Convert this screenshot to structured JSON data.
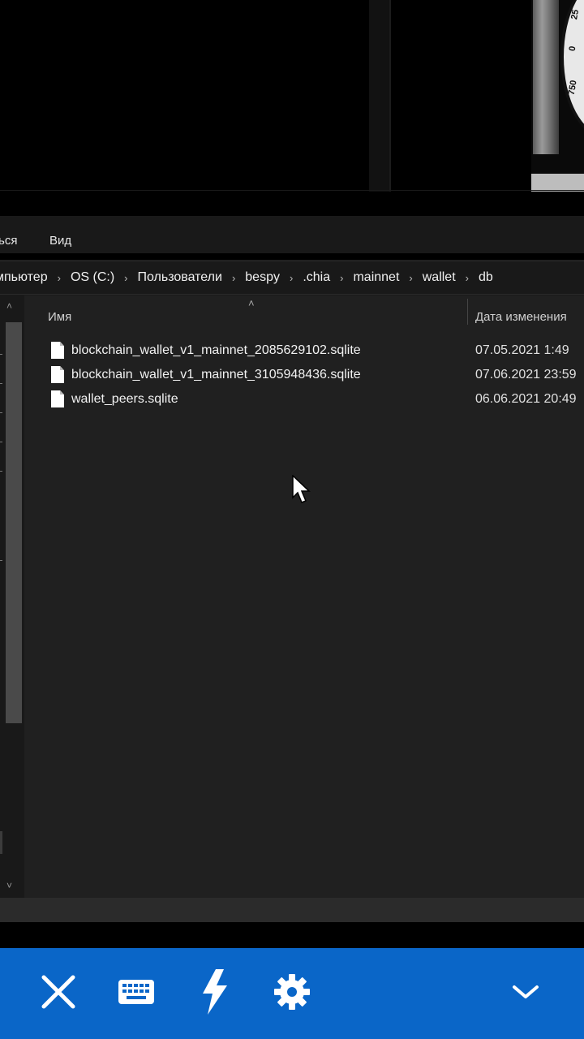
{
  "ribbon": {
    "share_label": "ься",
    "view_label": "Вид"
  },
  "breadcrumb": {
    "items": [
      "мпьютер",
      "OS (C:)",
      "Пользователи",
      "bespy",
      ".chia",
      "mainnet",
      "wallet",
      "db"
    ]
  },
  "columns": {
    "name": "Имя",
    "date": "Дата изменения"
  },
  "files": [
    {
      "name": "blockchain_wallet_v1_mainnet_2085629102.sqlite",
      "date": "07.05.2021 1:49"
    },
    {
      "name": "blockchain_wallet_v1_mainnet_3105948436.sqlite",
      "date": "07.06.2021 23:59"
    },
    {
      "name": "wallet_peers.sqlite",
      "date": "06.06.2021 20:49"
    }
  ],
  "background_photo": {
    "dial_numbers": [
      "25",
      "0",
      "750"
    ]
  },
  "toolbar": {
    "buttons": [
      "close-icon",
      "keyboard-icon",
      "lightning-icon",
      "gear-icon",
      "chevron-down-icon"
    ],
    "color": "#0a66c8"
  }
}
